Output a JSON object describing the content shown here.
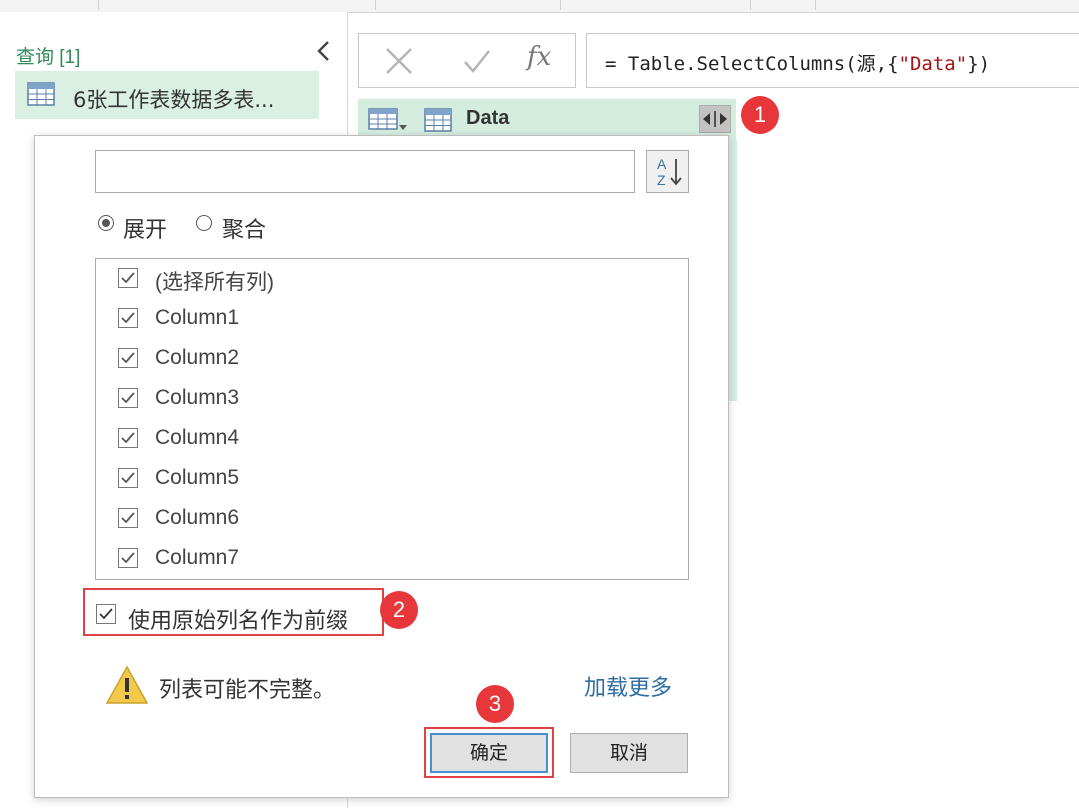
{
  "queries": {
    "header": "查询 [1]",
    "item_label": "6张工作表数据多表..."
  },
  "formula": {
    "prefix": "= Table.SelectColumns(源,{",
    "string": "\"Data\"",
    "suffix": "})",
    "fx_label": "fx"
  },
  "column_header": {
    "name": "Data"
  },
  "expand_popup": {
    "search_placeholder": "",
    "radio_expand": "展开",
    "radio_aggregate": "聚合",
    "selected_mode": "展开",
    "columns": [
      {
        "label": "(选择所有列)",
        "checked": true
      },
      {
        "label": "Column1",
        "checked": true
      },
      {
        "label": "Column2",
        "checked": true
      },
      {
        "label": "Column3",
        "checked": true
      },
      {
        "label": "Column4",
        "checked": true
      },
      {
        "label": "Column5",
        "checked": true
      },
      {
        "label": "Column6",
        "checked": true
      },
      {
        "label": "Column7",
        "checked": true
      }
    ],
    "prefix_checkbox_label": "使用原始列名作为前缀",
    "prefix_checked": true,
    "warning_text": "列表可能不完整。",
    "load_more_label": "加载更多",
    "ok_label": "确定",
    "cancel_label": "取消"
  },
  "annotations": {
    "badge_1": "1",
    "badge_2": "2",
    "badge_3": "3",
    "badge_color": "#e8373b"
  },
  "colors": {
    "accent_green": "#2e8b57",
    "selection_green": "#d4eddf",
    "link_blue": "#2e6da4"
  }
}
